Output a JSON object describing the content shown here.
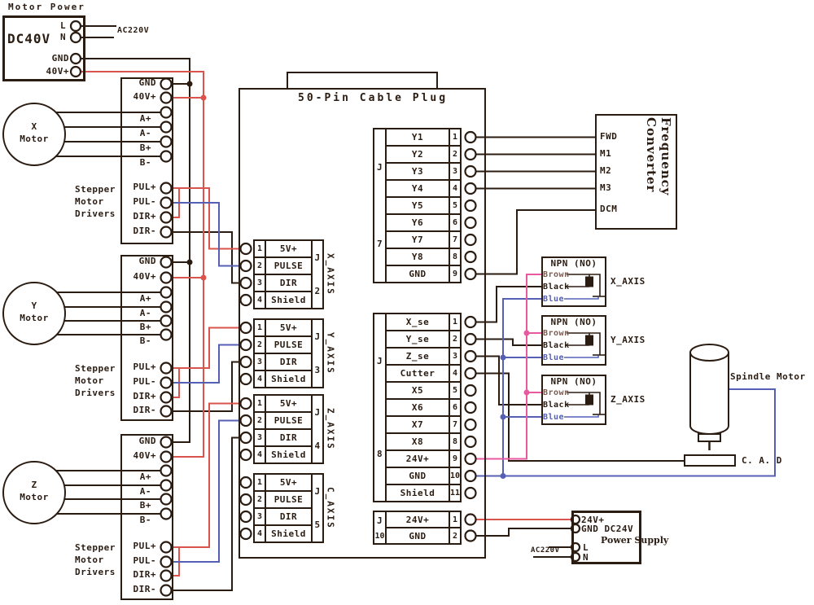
{
  "colors": {
    "ink": "#2b1c12",
    "red": "#d9544d",
    "blue": "#5560b5",
    "pink": "#e85aa0",
    "brown": "#7d5a4e"
  },
  "motor_power": {
    "title": "Motor Power",
    "model": "DC40V",
    "l": "L",
    "n": "N",
    "gnd": "GND",
    "v40": "40V+",
    "ac": "AC220V"
  },
  "drivers": {
    "note1": "Stepper",
    "note2": "Motor",
    "note3": "Drivers",
    "t": {
      "gnd": "GND",
      "v40": "40V+",
      "ap": "A+",
      "am": "A-",
      "bp": "B+",
      "bm": "B-",
      "pulp": "PUL+",
      "pulm": "PUL-",
      "dirp": "DIR+",
      "dirm": "DIR-"
    },
    "motors": [
      {
        "l1": "X",
        "l2": "Motor"
      },
      {
        "l1": "Y",
        "l2": "Motor"
      },
      {
        "l1": "Z",
        "l2": "Motor"
      }
    ]
  },
  "plug": {
    "title": "50-Pin Cable Plug",
    "axis_rows": [
      {
        "n": "1",
        "label": "5V+"
      },
      {
        "n": "2",
        "label": "PULSE"
      },
      {
        "n": "3",
        "label": "DIR"
      },
      {
        "n": "4",
        "label": "Shield"
      }
    ],
    "axis": [
      {
        "j": "J",
        "num": "2",
        "name": "X_AXIS"
      },
      {
        "j": "J",
        "num": "3",
        "name": "Y_AXIS"
      },
      {
        "j": "J",
        "num": "4",
        "name": "Z_AXIS"
      },
      {
        "j": "J",
        "num": "5",
        "name": "C_AXIS"
      }
    ],
    "j7": {
      "j": "J",
      "num": "7",
      "rows": [
        {
          "label": "Y1",
          "pin": "1"
        },
        {
          "label": "Y2",
          "pin": "2"
        },
        {
          "label": "Y3",
          "pin": "3"
        },
        {
          "label": "Y4",
          "pin": "4"
        },
        {
          "label": "Y5",
          "pin": "5"
        },
        {
          "label": "Y6",
          "pin": "6"
        },
        {
          "label": "Y7",
          "pin": "7"
        },
        {
          "label": "Y8",
          "pin": "8"
        },
        {
          "label": "GND",
          "pin": "9"
        }
      ]
    },
    "j8": {
      "j": "J",
      "num": "8",
      "rows": [
        {
          "label": "X_se",
          "pin": "1"
        },
        {
          "label": "Y_se",
          "pin": "2"
        },
        {
          "label": "Z_se",
          "pin": "3"
        },
        {
          "label": "Cutter",
          "pin": "4"
        },
        {
          "label": "X5",
          "pin": "5"
        },
        {
          "label": "X6",
          "pin": "6"
        },
        {
          "label": "X7",
          "pin": "7"
        },
        {
          "label": "X8",
          "pin": "8"
        },
        {
          "label": "24V+",
          "pin": "9"
        },
        {
          "label": "GND",
          "pin": "10"
        },
        {
          "label": "Shield",
          "pin": "11"
        }
      ]
    },
    "j10": {
      "j": "J",
      "num": "10",
      "rows": [
        {
          "label": "24V+",
          "pin": "1"
        },
        {
          "label": "GND",
          "pin": "2"
        }
      ]
    }
  },
  "freq": {
    "title": "Frequency Converter",
    "t": [
      "FWD",
      "M1",
      "M2",
      "M3",
      "DCM"
    ]
  },
  "sensors": {
    "title": "NPN (NO)",
    "brown": "Brown",
    "black": "Black",
    "blue": "Blue",
    "axes": [
      "X_AXIS",
      "Y_AXIS",
      "Z_AXIS"
    ]
  },
  "spindle": {
    "label": "Spindle Motor"
  },
  "cad": {
    "label": "C. A. D"
  },
  "ps": {
    "v24": "24V+",
    "gnd": "GND DC24V",
    "title": "Power Supply",
    "l": "L",
    "n": "N",
    "ac": "AC220V"
  }
}
